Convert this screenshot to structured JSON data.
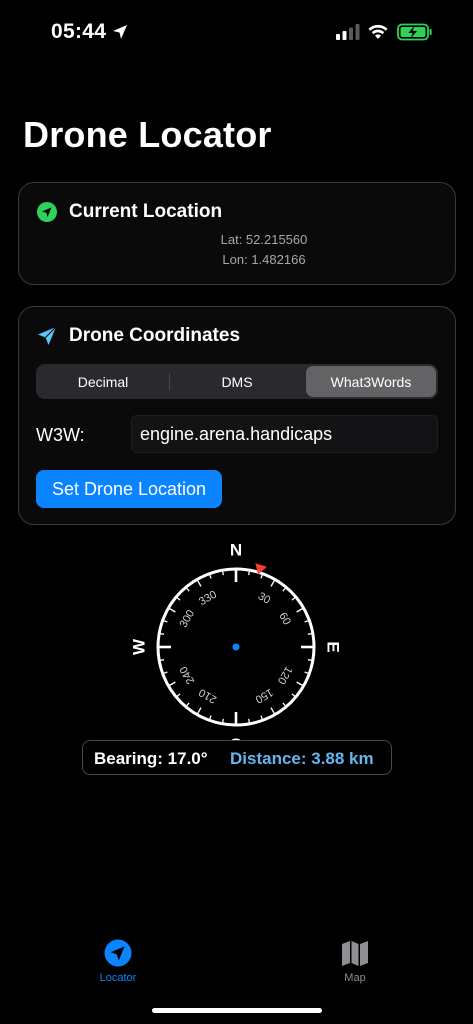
{
  "status_bar": {
    "time": "05:44",
    "icons": [
      "location-arrow-icon",
      "cellular-signal-icon",
      "wifi-icon",
      "battery-charging-icon"
    ]
  },
  "page_title": "Drone Locator",
  "current_location": {
    "title": "Current Location",
    "icon": "location-arrow-icon",
    "icon_color": "#30d158",
    "lat": "Lat: 52.215560",
    "lon": "Lon: 1.482166"
  },
  "drone_coordinates": {
    "title": "Drone Coordinates",
    "icon": "paper-plane-icon",
    "icon_color": "#5ac8fa",
    "tabs": [
      {
        "label": "Decimal",
        "selected": false
      },
      {
        "label": "DMS",
        "selected": false
      },
      {
        "label": "What3Words",
        "selected": true
      }
    ],
    "w3w_label": "W3W:",
    "w3w_value": "engine.arena.handicaps",
    "set_button": "Set Drone Location",
    "accent": "#0a84ff"
  },
  "compass": {
    "cardinals": {
      "n": "N",
      "e": "E",
      "s": "S",
      "w": "W"
    },
    "degree_labels": [
      "30",
      "60",
      "120",
      "150",
      "210",
      "240",
      "300",
      "330"
    ],
    "marker_color": "#ff3b30",
    "center_dot_color": "#0a84ff"
  },
  "info": {
    "bearing": "Bearing: 17.0°",
    "distance": "Distance: 3.88 km",
    "distance_color": "#64b5f0"
  },
  "tab_bar": {
    "items": [
      {
        "label": "Locator",
        "icon": "location-arrow-icon",
        "selected": true
      },
      {
        "label": "Map",
        "icon": "map-icon",
        "selected": false
      }
    ]
  }
}
